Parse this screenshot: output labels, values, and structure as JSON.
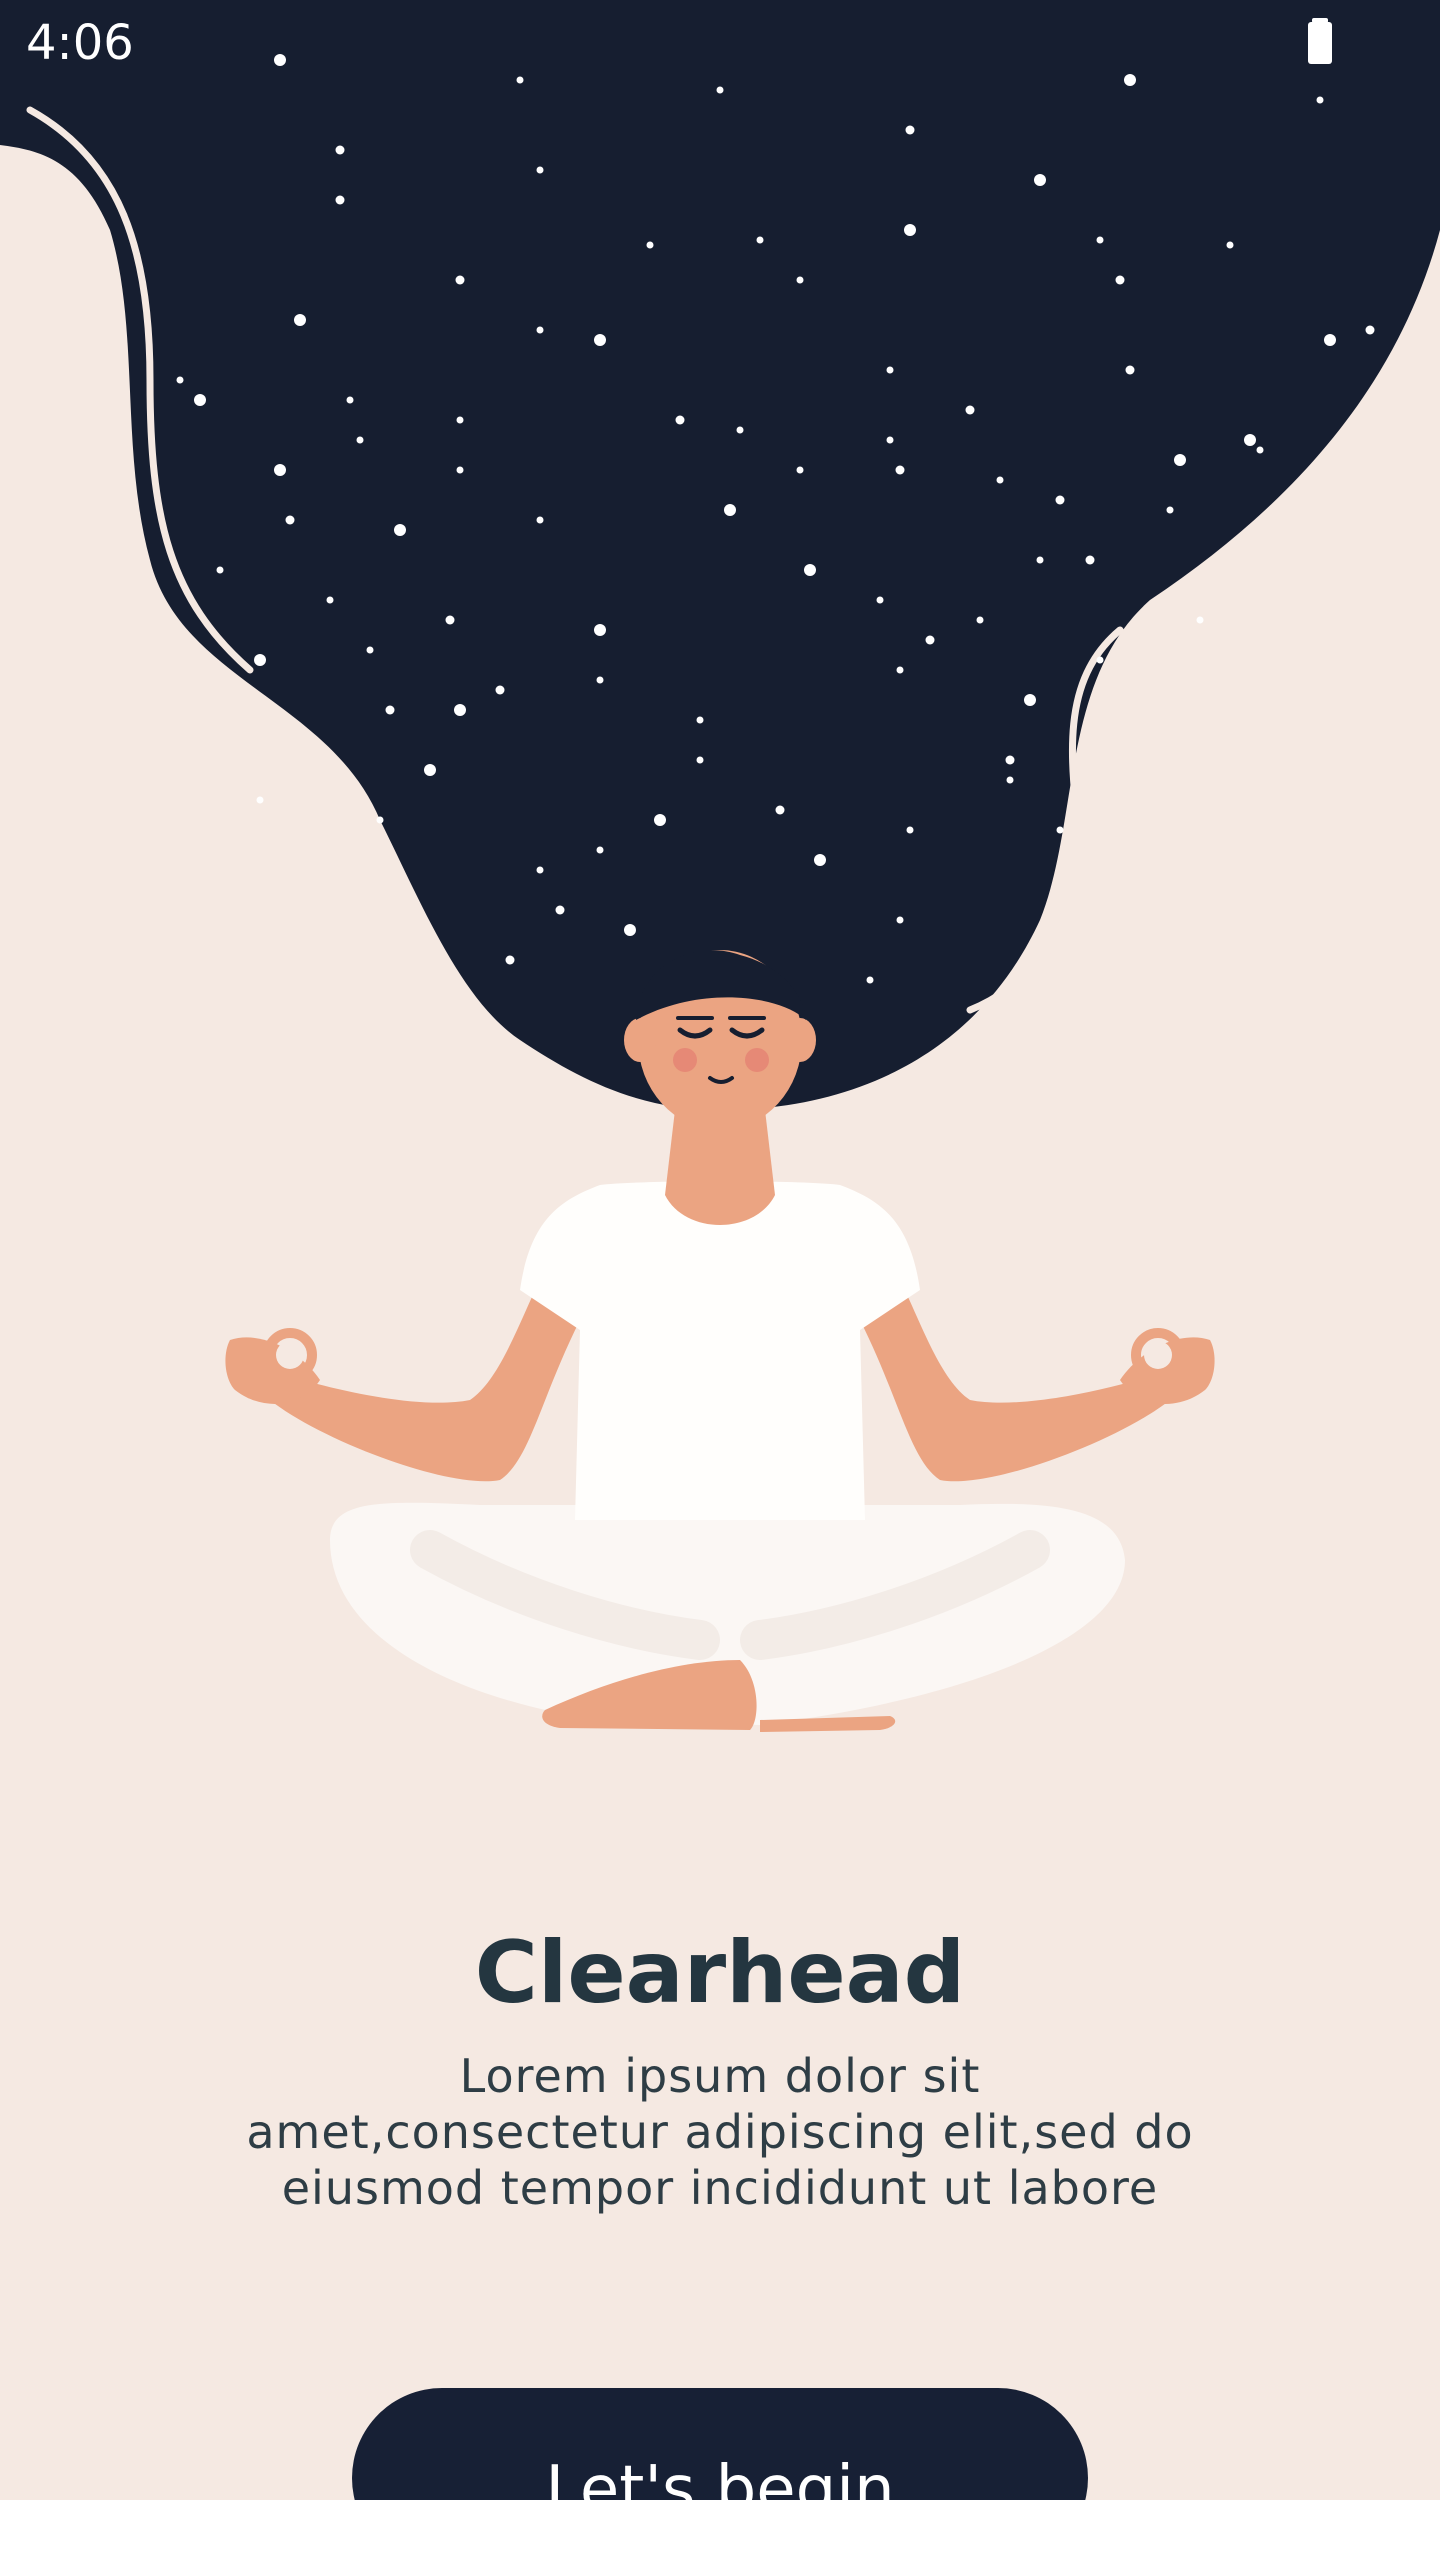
{
  "status_bar": {
    "time": "4:06",
    "battery_icon": "battery-full-icon"
  },
  "illustration": {
    "subject": "meditating-woman-starry-hair-illustration",
    "colors": {
      "hair": "#161E30",
      "skin": "#EBA482",
      "clothes": "#FFFFFF",
      "background": "#F5E9E2",
      "stars": "#FFFFFF"
    }
  },
  "content": {
    "title": "Clearhead",
    "subtitle_lines": [
      "Lorem ipsum dolor sit",
      "amet,consectetur adipiscing elit,sed do",
      "eiusmod tempor incididunt ut labore"
    ]
  },
  "actions": {
    "begin_label": "Let's begin"
  },
  "theme": {
    "accent": "#172035",
    "title_color": "#243640",
    "background": "#F5E9E2"
  }
}
